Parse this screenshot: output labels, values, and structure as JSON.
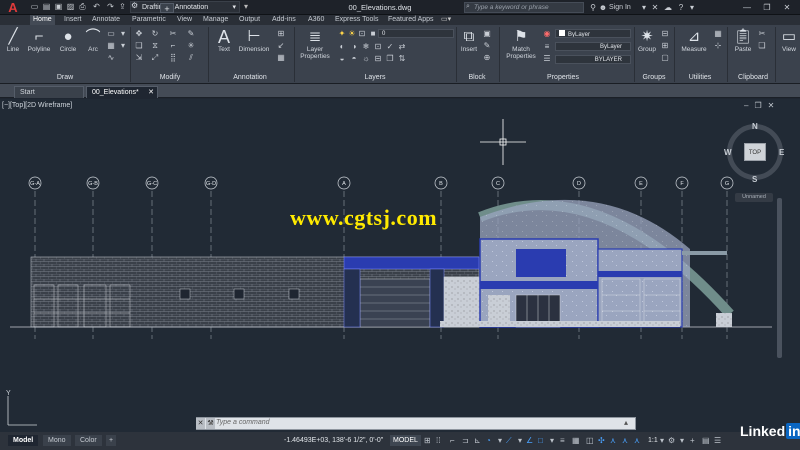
{
  "app": {
    "logo": "A",
    "title": "00_Elevations.dwg"
  },
  "quick_access": [
    "new",
    "open",
    "save",
    "saveas",
    "print",
    "undo",
    "redo",
    "share"
  ],
  "workspace": "Drafting & Annotation",
  "search": {
    "placeholder": "Type a keyword or phrase"
  },
  "user": {
    "sign_in": "Sign In"
  },
  "ribbon_tabs": [
    "Home",
    "Insert",
    "Annotate",
    "Parametric",
    "View",
    "Manage",
    "Output",
    "Add-ins",
    "A360",
    "Express Tools",
    "Featured Apps"
  ],
  "ribbon": {
    "draw": {
      "title": "Draw",
      "tools": [
        "Line",
        "Polyline",
        "Circle",
        "Arc"
      ]
    },
    "modify": {
      "title": "Modify"
    },
    "annotation": {
      "title": "Annotation",
      "tools": [
        "Text",
        "Dimension"
      ]
    },
    "layers": {
      "title": "Layers",
      "tool": "Layer Properties",
      "current": "0"
    },
    "block": {
      "title": "Block",
      "tool": "Insert"
    },
    "properties": {
      "title": "Properties",
      "tool": "Match Properties",
      "color": "ByLayer",
      "linetype": "ByLayer",
      "lineweight": "BYLAYER"
    },
    "groups": {
      "title": "Groups",
      "tool": "Group"
    },
    "utilities": {
      "title": "Utilities",
      "tool": "Measure"
    },
    "clipboard": {
      "title": "Clipboard",
      "tool": "Paste"
    },
    "view": {
      "tool": "View"
    }
  },
  "doc_tabs": [
    "Start",
    "00_Elevations*"
  ],
  "viewport": {
    "label": "[−][Top][2D Wireframe]",
    "compass": {
      "n": "N",
      "s": "S",
      "e": "E",
      "w": "W",
      "face": "TOP"
    },
    "ucs": "Unnamed",
    "ucs_axis": "Y"
  },
  "drawing": {
    "grid_labels_left": [
      "G-A",
      "G-B",
      "G-C",
      "G-D"
    ],
    "grid_labels_right": [
      "A",
      "B",
      "C",
      "D",
      "E",
      "F",
      "G"
    ]
  },
  "watermark": "www.cgtsj.com",
  "command": {
    "placeholder": "Type a command"
  },
  "layout_tabs": [
    "Model",
    "Mono",
    "Color"
  ],
  "status": {
    "coords": "-1.46493E+03, 138'-6 1/2\", 0'-0\"",
    "mode": "MODEL",
    "scale": "1:1"
  },
  "brand": {
    "linked": "Linked",
    "in": "in"
  },
  "colors": {
    "ribbon": "#3b424d",
    "viewport": "#212a35",
    "building_blue": "#2a3cb0",
    "glass": "#9aa6c0"
  }
}
